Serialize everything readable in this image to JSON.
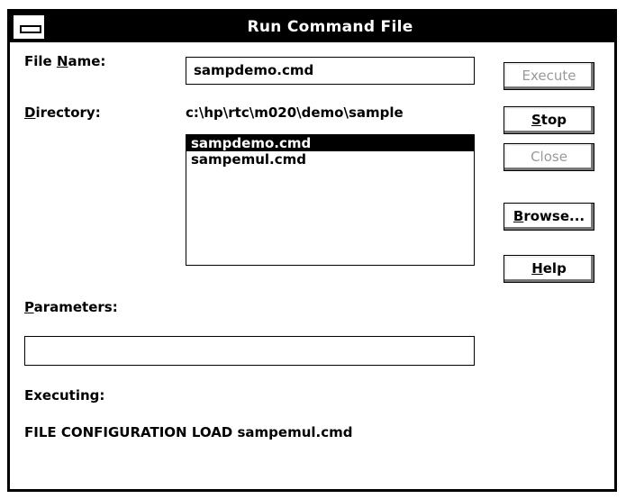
{
  "window": {
    "title": "Run Command File"
  },
  "form": {
    "file_name_label_pre": "File ",
    "file_name_label_key": "N",
    "file_name_label_post": "ame:",
    "file_name_value": "sampdemo.cmd",
    "directory_label_key": "D",
    "directory_label_post": "irectory:",
    "directory_value": "c:\\hp\\rtc\\m020\\demo\\sample",
    "files": [
      "sampdemo.cmd",
      "sampemul.cmd"
    ],
    "selected_file": "sampdemo.cmd",
    "parameters_label_key": "P",
    "parameters_label_post": "arameters:",
    "parameters_value": "",
    "executing_label": "Executing:",
    "executing_value": "FILE CONFIGURATION LOAD sampemul.cmd"
  },
  "buttons": {
    "execute": "Execute",
    "stop_key": "S",
    "stop_rest": "top",
    "close": "Close",
    "browse_key": "B",
    "browse_rest": "rowse...",
    "help_key": "H",
    "help_rest": "elp"
  }
}
